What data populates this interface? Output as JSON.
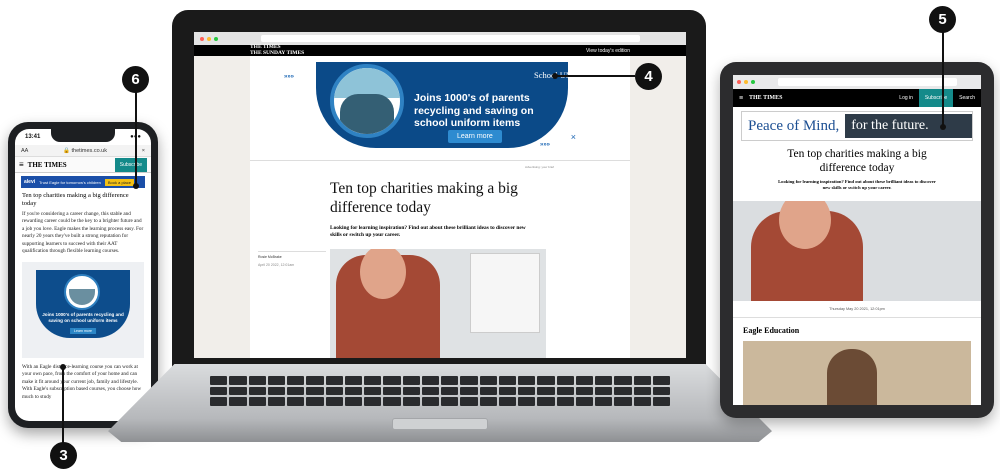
{
  "phone": {
    "time": "13:41",
    "signal": "●●●",
    "aa": "AA",
    "url": "thetimes.co.uk",
    "menu_icon": "≡",
    "lock_icon": "🔒",
    "close_icon": "×",
    "logo": "THE TIMES",
    "subscribe": "Subscribe",
    "ad_logo": "alevi",
    "ad_text": "Trust Eagle for tomorrow's children",
    "ad_button": "Book a place",
    "headline": "Ten top charities making a big difference today",
    "body1": "If you're considering a career change, this stable and rewarding career could be the key to a brighter future and a job you love. Eagle makes the learning process easy. For nearly 20 years they've built a strong reputation for supporting learners to succeed with their AAT qualification through flexible learning courses.",
    "ad_caption": "Joins 1000's of parents recycling and saving on school uniform items",
    "ad_button2": "Learn more",
    "body2": "With an Eagle distance-learning course you can work at your own pace, from the comfort of your home and can make it fit around your current job, family and lifestyle. With Eagle's subscription based courses, you choose how much to study"
  },
  "laptop": {
    "logo": "THE TIMES\nTHE SUNDAY TIMES",
    "edition": "View today's edition",
    "ad": {
      "title": "Joins 1000's of parents recycling and saving on school uniform items",
      "brand": "School UNIFORM",
      "button": "Learn more",
      "chevrons": "»»»",
      "close": "×"
    },
    "advert_note": "Advertising: your brief",
    "headline": "Ten top charities making a big difference today",
    "standfirst": "Looking for learning inspiration? Find out about these brilliant ideas to discover new skills or switch up your career.",
    "byline": "Rosie McBrake",
    "date": "April 20 2022, 12:01am"
  },
  "tablet": {
    "menu_icon": "≡",
    "logo": "THE TIMES",
    "login": "Log in",
    "subscribe": "Subscribe",
    "search": "Search",
    "ad_left": "Peace of Mind,",
    "ad_right": "for the future.",
    "headline": "Ten top charities making a big difference today",
    "standfirst": "Looking for learning inspiration? Find out about these brilliant ideas to discover new skills or switch up your career.",
    "date": "Thursday May 20 2021, 12:01pm",
    "section": "Eagle Education"
  },
  "callouts": [
    "3",
    "4",
    "5",
    "6"
  ],
  "colors": {
    "brand_teal": "#148a8a",
    "ad_blue": "#0b4a88",
    "marker": "#111111"
  }
}
